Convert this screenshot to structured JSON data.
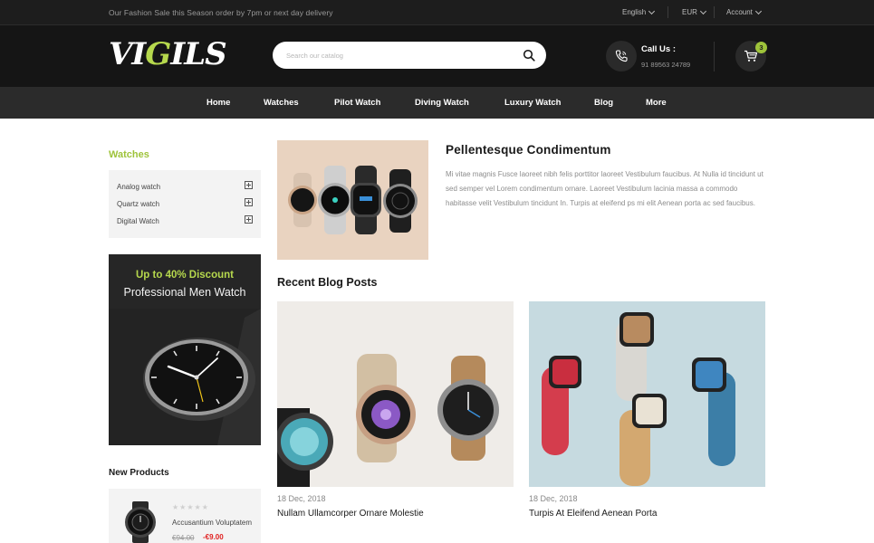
{
  "topbar": {
    "promo": "Our Fashion Sale this Season order by 7pm or next day delivery",
    "language": "English",
    "currency": "EUR",
    "account": "Account"
  },
  "header": {
    "logo_text_1": "VI",
    "logo_text_accent": "G",
    "logo_text_2": "ILS",
    "search_placeholder": "Search our catalog",
    "call_title": "Call Us :",
    "call_number": "91 89563 24789",
    "cart_count": "3",
    "accent_color": "#9ec33a"
  },
  "nav": {
    "items": [
      "Home",
      "Watches",
      "Pilot Watch",
      "Diving Watch",
      "Luxury Watch",
      "Blog",
      "More"
    ]
  },
  "sidebar": {
    "heading": "Watches",
    "categories": [
      "Analog watch",
      "Quartz watch",
      "Digital Watch"
    ],
    "banner": {
      "line1": "Up to 40% Discount",
      "line2": "Professional Men Watch"
    },
    "new_products_heading": "New Products",
    "product": {
      "name": "Accusantium Voluptatem",
      "rating": 0,
      "old_price": "€94.00",
      "new_price": "-€9.00"
    }
  },
  "featured": {
    "title": "Pellentesque Condimentum",
    "description": "Mi vitae magnis Fusce laoreet nibh felis porttitor laoreet Vestibulum faucibus. At Nulla id tincidunt ut sed semper vel Lorem condimentum ornare. Laoreet Vestibulum lacinia massa a commodo habitasse velit Vestibulum tincidunt In. Turpis at eleifend ps mi elit Aenean porta ac sed faucibus."
  },
  "blog": {
    "heading": "Recent Blog Posts",
    "posts": [
      {
        "date": "18 Dec, 2018",
        "title": "Nullam Ullamcorper Ornare Molestie"
      },
      {
        "date": "18 Dec, 2018",
        "title": "Turpis At Eleifend Aenean Porta"
      }
    ]
  }
}
